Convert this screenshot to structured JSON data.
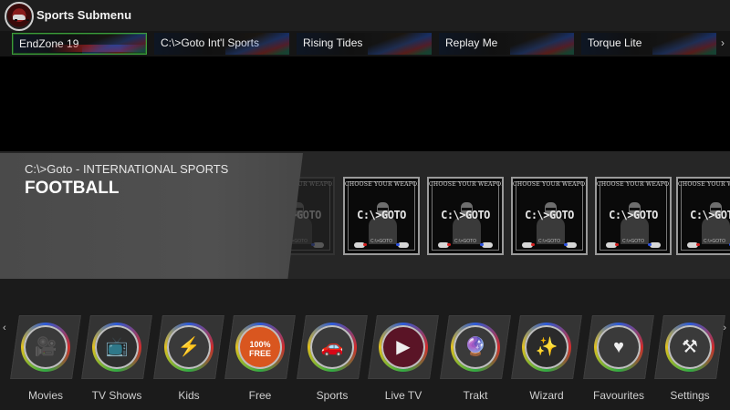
{
  "header": {
    "title": "Sports Submenu",
    "logo_icon": "red-car-logo-icon"
  },
  "submenu": {
    "active_index": 0,
    "tabs": [
      {
        "label": "EndZone 19"
      },
      {
        "label": "C:\\>Goto Int'l Sports"
      },
      {
        "label": "Rising Tides"
      },
      {
        "label": "Replay Me"
      },
      {
        "label": "Torque Lite"
      }
    ],
    "more_icon": "chevron-right-icon"
  },
  "shelf": {
    "category": "C:\\>Goto - INTERNATIONAL SPORTS",
    "title": "FOOTBALL",
    "thumbnail": {
      "caption_top": "CHOOSE YOUR WEAPON",
      "logo_text": "C:\\>GOTO",
      "caption_bottom": "C:\\>GOTO",
      "icon": "goto-addon-thumbnail-icon"
    },
    "colors": {
      "panel": "#4a4a4a",
      "background": "#262626"
    }
  },
  "main_menu": {
    "items": [
      {
        "label": "Movies",
        "icon": "film-camera-icon",
        "inner_color": "#3a3a3a"
      },
      {
        "label": "TV Shows",
        "icon": "retro-tv-icon",
        "inner_color": "#2e2e2e"
      },
      {
        "label": "Kids",
        "icon": "pikachu-icon",
        "inner_color": "#3a3a3a"
      },
      {
        "label": "Free",
        "icon": "free-drop-icon",
        "inner_color": "#d9561f",
        "badge_line1": "100%",
        "badge_line2": "FREE"
      },
      {
        "label": "Sports",
        "icon": "sports-car-icon",
        "inner_color": "#3a3a3a"
      },
      {
        "label": "Live TV",
        "icon": "live-tv-icon",
        "inner_color": "#5a1426"
      },
      {
        "label": "Trakt",
        "icon": "crystal-ball-icon",
        "inner_color": "#3a3a3a"
      },
      {
        "label": "Wizard",
        "icon": "wizard-hat-icon",
        "inner_color": "#2a2a2a"
      },
      {
        "label": "Favourites",
        "icon": "heart-hand-icon",
        "inner_color": "#3a3a3a"
      },
      {
        "label": "Settings",
        "icon": "tools-icon",
        "inner_color": "#3a3a3a"
      }
    ],
    "prev_icon": "chevron-left-icon",
    "next_icon": "chevron-right-icon"
  }
}
